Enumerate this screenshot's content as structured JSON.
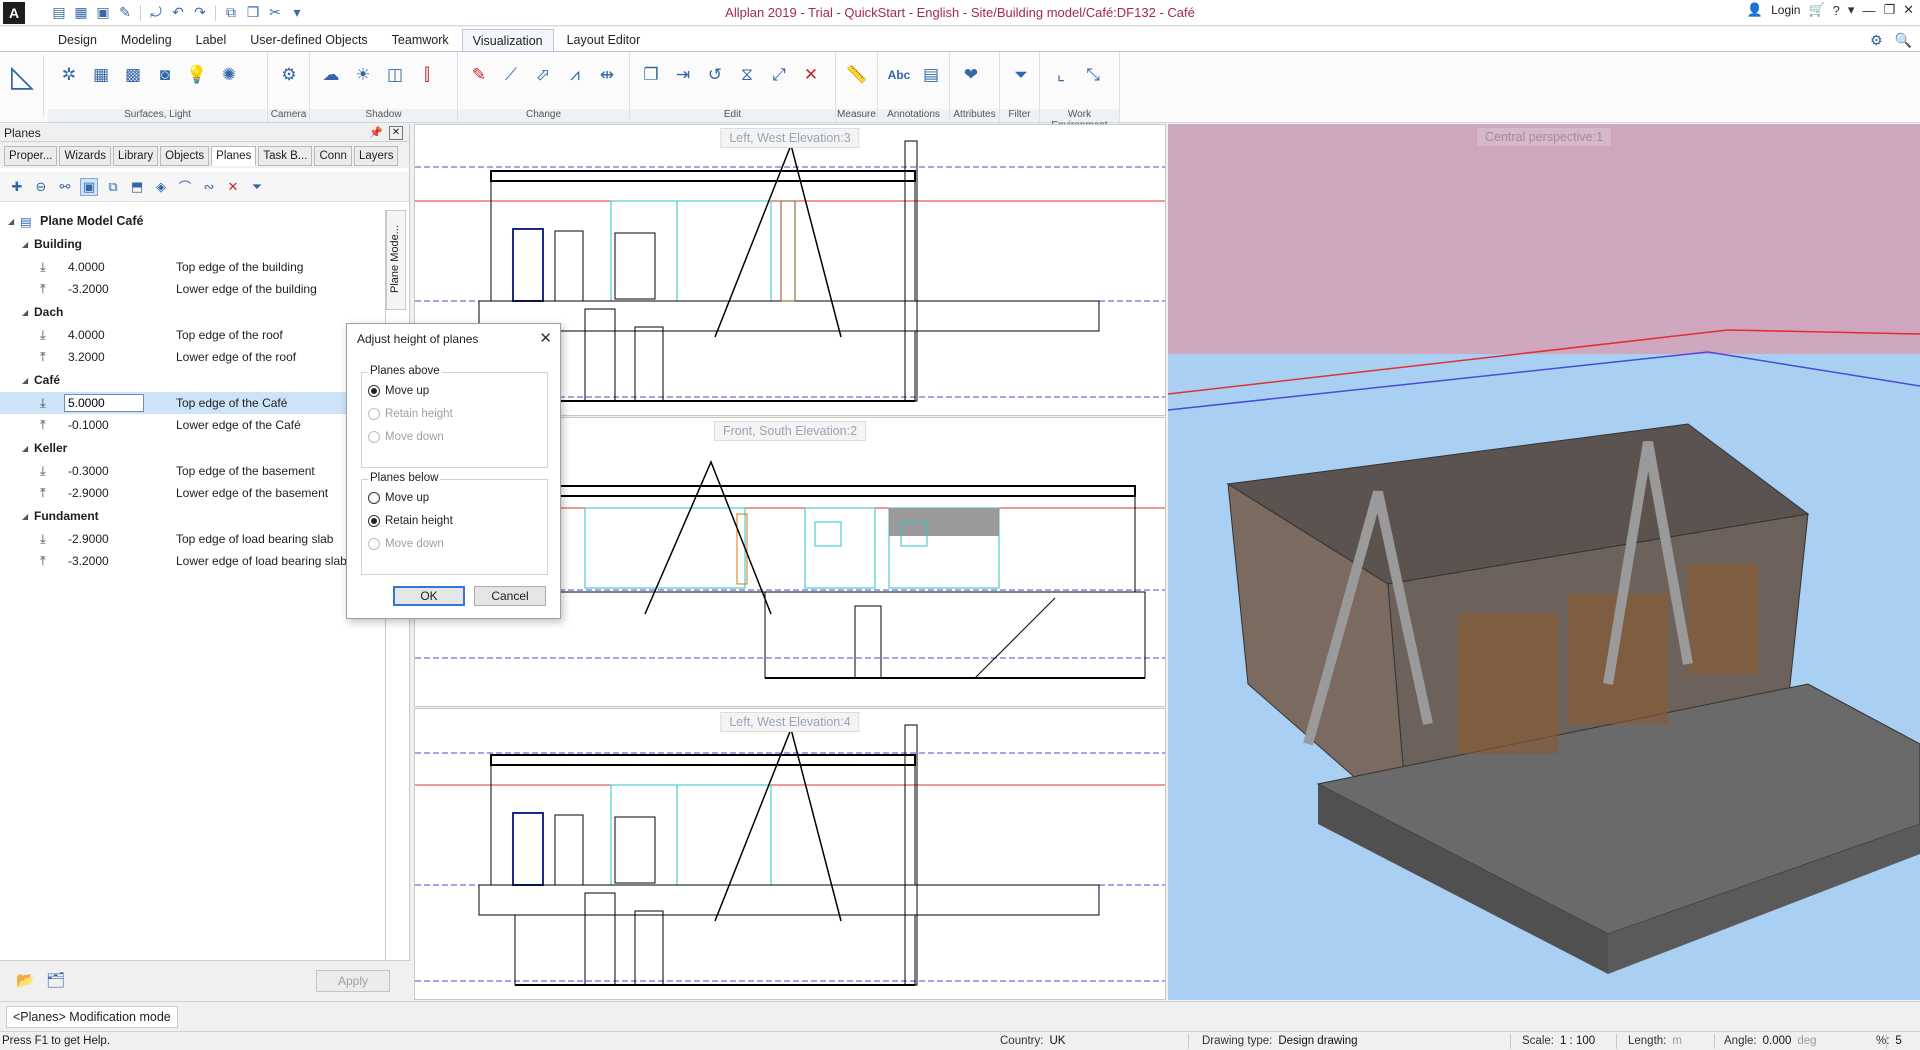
{
  "titlebar": {
    "title": "Allplan 2019 - Trial - QuickStart - English - Site/Building model/Café:DF132 - Café",
    "login": "Login",
    "help": "?"
  },
  "ribbon": {
    "tabs": [
      "Design",
      "Modeling",
      "Label",
      "User-defined Objects",
      "Teamwork",
      "Visualization",
      "Layout Editor"
    ],
    "active_tab": "Visualization",
    "groups": [
      "Surfaces, Light",
      "Camera",
      "Shadow",
      "Change",
      "Edit",
      "Measure",
      "Annotations",
      "Attributes",
      "Filter",
      "Work Environment"
    ],
    "annotation_text": "Abc"
  },
  "panel": {
    "title": "Planes",
    "tabs": [
      "Proper...",
      "Wizards",
      "Library",
      "Objects",
      "Planes",
      "Task B...",
      "Conn",
      "Layers"
    ],
    "active_tab": "Planes",
    "side_tab": "Plane Mode...",
    "tree": {
      "root": "Plane Model Café",
      "groups": [
        {
          "name": "Building",
          "planes": [
            {
              "value": "4.0000",
              "label": "Top edge of the building"
            },
            {
              "value": "-3.2000",
              "label": "Lower edge of the building"
            }
          ]
        },
        {
          "name": "Dach",
          "planes": [
            {
              "value": "4.0000",
              "label": "Top edge of the roof"
            },
            {
              "value": "3.2000",
              "label": "Lower edge of the roof"
            }
          ]
        },
        {
          "name": "Café",
          "planes": [
            {
              "value": "5.0000",
              "label": "Top edge of the Café"
            },
            {
              "value": "-0.1000",
              "label": "Lower edge of the Café"
            }
          ]
        },
        {
          "name": "Keller",
          "planes": [
            {
              "value": "-0.3000",
              "label": "Top edge of the basement"
            },
            {
              "value": "-2.9000",
              "label": "Lower edge of the basement"
            }
          ]
        },
        {
          "name": "Fundament",
          "planes": [
            {
              "value": "-2.9000",
              "label": "Top edge of load bearing slab"
            },
            {
              "value": "-3.2000",
              "label": "Lower edge of load bearing slab"
            }
          ]
        }
      ]
    },
    "apply_label": "Apply"
  },
  "viewports": {
    "top": "Left, West Elevation:3",
    "middle": "Front, South Elevation:2",
    "bottom": "Left, West Elevation:4",
    "perspective": "Central perspective:1"
  },
  "dialog": {
    "title": "Adjust height of planes",
    "above": {
      "legend": "Planes above",
      "options": [
        "Move up",
        "Retain height",
        "Move down"
      ],
      "selected": "Move up"
    },
    "below": {
      "legend": "Planes below",
      "options": [
        "Move up",
        "Retain height",
        "Move down"
      ],
      "selected": "Retain height"
    },
    "ok": "OK",
    "cancel": "Cancel"
  },
  "modebar": {
    "mode": "<Planes> Modification mode"
  },
  "status": {
    "help": "Press F1 to get Help.",
    "country_label": "Country:",
    "country": "UK",
    "drawing_type_label": "Drawing type:",
    "drawing_type": "Design drawing",
    "scale_label": "Scale:",
    "scale": "1 : 100",
    "length_label": "Length:",
    "length_unit": "m",
    "angle_label": "Angle:",
    "angle": "0.000",
    "angle_unit": "deg",
    "percent_label": "%:",
    "percent": "5"
  },
  "colors": {
    "title_text": "#a3275a",
    "accent_blue": "#3367a9",
    "sky": "#a9d0f3",
    "horizon": "#cfa8bf",
    "plane_red": "#e03030",
    "plane_blue": "#4a4ad8"
  }
}
